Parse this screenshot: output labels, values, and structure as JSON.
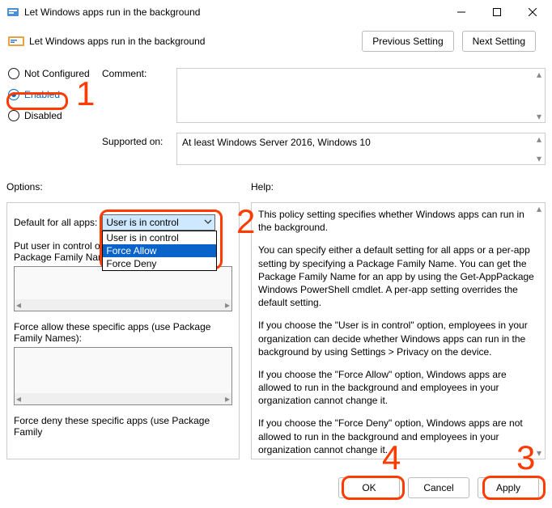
{
  "window": {
    "title": "Let Windows apps run in the background"
  },
  "subheader": {
    "title": "Let Windows apps run in the background"
  },
  "nav": {
    "prev": "Previous Setting",
    "next": "Next Setting"
  },
  "state": {
    "options": [
      "Not Configured",
      "Enabled",
      "Disabled"
    ],
    "not_configured": "Not Configured",
    "enabled": "Enabled",
    "disabled": "Disabled",
    "selected_index": 1
  },
  "labels": {
    "comment": "Comment:",
    "supported_on": "Supported on:",
    "options": "Options:",
    "help": "Help:"
  },
  "supported_on": {
    "text": "At least Windows Server 2016, Windows 10"
  },
  "options_panel": {
    "default_label": "Default for all apps:",
    "dropdown": {
      "value": "User is in control",
      "items": [
        "User is in control",
        "Force Allow",
        "Force Deny"
      ],
      "highlighted_index": 1
    },
    "user_control_label": "Put user in control of these specific apps (use Package Family Names):",
    "user_contol_label_trunc": "Put user in control of",
    "user_contol_label_trunc2": "Package Family Nam",
    "force_allow_label": "Force allow these specific apps (use Package Family Names):",
    "force_deny_label": "Force deny these specific apps (use Package Family"
  },
  "help_text": {
    "p1": "This policy setting specifies whether Windows apps can run in the background.",
    "p2": "You can specify either a default setting for all apps or a per-app setting by specifying a Package Family Name. You can get the Package Family Name for an app by using the Get-AppPackage Windows PowerShell cmdlet. A per-app setting overrides the default setting.",
    "p3": "If you choose the \"User is in control\" option, employees in your organization can decide whether Windows apps can run in the background by using Settings > Privacy on the device.",
    "p4": "If you choose the \"Force Allow\" option, Windows apps are allowed to run in the background and employees in your organization cannot change it.",
    "p5": "If you choose the \"Force Deny\" option, Windows apps are not allowed to run in the background and employees in your organization cannot change it."
  },
  "buttons": {
    "ok": "OK",
    "cancel": "Cancel",
    "apply": "Apply"
  },
  "annotations": {
    "n1": "1",
    "n2": "2",
    "n3": "3",
    "n4": "4"
  }
}
